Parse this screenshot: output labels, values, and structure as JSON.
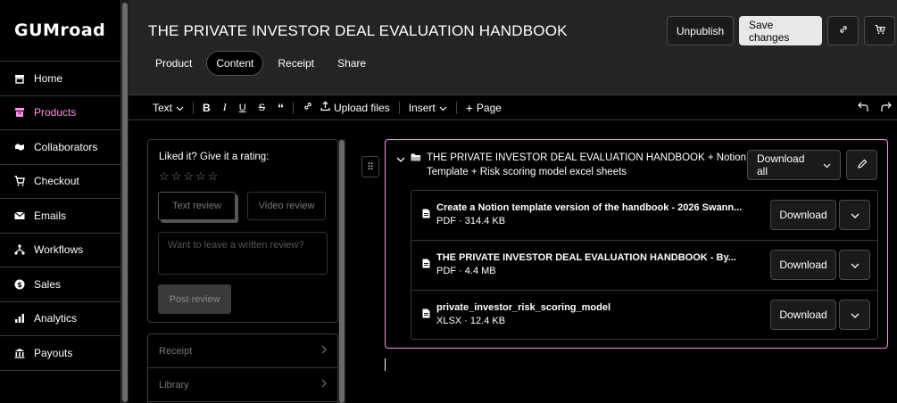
{
  "brand": {
    "logo": "GUMroad",
    "accent": "#ff90e8"
  },
  "sidebar": {
    "items": [
      {
        "label": "Home",
        "icon": "store-icon"
      },
      {
        "label": "Products",
        "icon": "archive-icon",
        "active": true
      },
      {
        "label": "Collaborators",
        "icon": "handshake-icon"
      },
      {
        "label": "Checkout",
        "icon": "cart-icon"
      },
      {
        "label": "Emails",
        "icon": "envelope-icon"
      },
      {
        "label": "Workflows",
        "icon": "diagram-icon"
      },
      {
        "label": "Sales",
        "icon": "dollar-circle-icon"
      },
      {
        "label": "Analytics",
        "icon": "bar-chart-icon"
      },
      {
        "label": "Payouts",
        "icon": "bank-icon"
      }
    ]
  },
  "header": {
    "title": "THE PRIVATE INVESTOR DEAL EVALUATION HANDBOOK",
    "tabs": [
      {
        "label": "Product"
      },
      {
        "label": "Content",
        "active": true
      },
      {
        "label": "Receipt"
      },
      {
        "label": "Share"
      }
    ],
    "unpublish_label": "Unpublish",
    "save_label": "Save changes"
  },
  "toolbar": {
    "text_label": "Text",
    "upload_label": "Upload files",
    "insert_label": "Insert",
    "page_label": "Page"
  },
  "preview": {
    "rating_label": "Liked it? Give it a rating:",
    "text_review_label": "Text review",
    "video_review_label": "Video review",
    "review_placeholder": "Want to leave a written review?",
    "post_label": "Post review",
    "links": [
      {
        "label": "Receipt"
      },
      {
        "label": "Library"
      }
    ]
  },
  "folder": {
    "title": "THE PRIVATE INVESTOR DEAL EVALUATION HANDBOOK + Notion Template + Risk scoring model excel sheets",
    "download_all_label": "Download all",
    "files": [
      {
        "name": "Create a Notion template version of the handbook - 2026 Swann...",
        "meta": "PDF · 314.4 KB",
        "download_label": "Download"
      },
      {
        "name": "THE PRIVATE INVESTOR DEAL EVALUATION HANDBOOK - By...",
        "meta": "PDF · 4.4 MB",
        "download_label": "Download"
      },
      {
        "name": "private_investor_risk_scoring_model",
        "meta": "XLSX · 12.4 KB",
        "download_label": "Download"
      }
    ]
  }
}
